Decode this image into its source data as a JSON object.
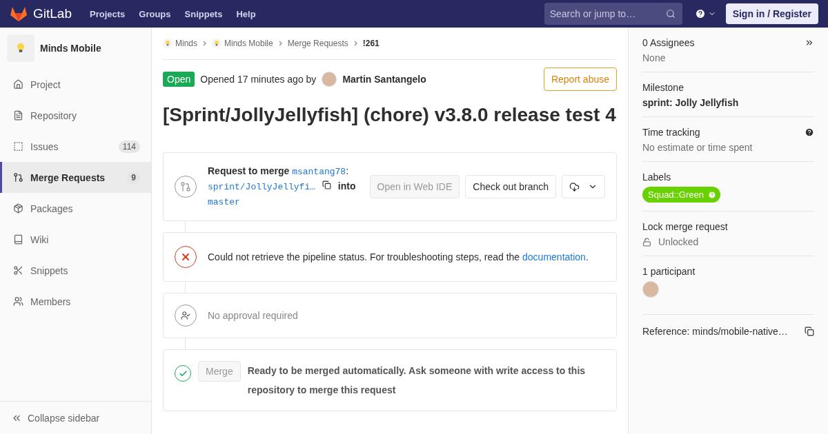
{
  "topbar": {
    "brand": "GitLab",
    "nav": [
      "Projects",
      "Groups",
      "Snippets",
      "Help"
    ],
    "search": {
      "placeholder": "Search or jump to…"
    },
    "signin": "Sign in / Register"
  },
  "sidebar": {
    "project": "Minds Mobile",
    "items": [
      {
        "label": "Project",
        "selected": false
      },
      {
        "label": "Repository",
        "selected": false
      },
      {
        "label": "Issues",
        "count": "114",
        "selected": false
      },
      {
        "label": "Merge Requests",
        "count": "9",
        "selected": true
      },
      {
        "label": "Packages",
        "selected": false
      },
      {
        "label": "Wiki",
        "selected": false
      },
      {
        "label": "Snippets",
        "selected": false
      },
      {
        "label": "Members",
        "selected": false
      }
    ],
    "collapse": "Collapse sidebar"
  },
  "breadcrumbs": [
    "Minds",
    "Minds Mobile",
    "Merge Requests",
    "!261"
  ],
  "header": {
    "status": "Open",
    "opened": "Opened 17 minutes ago by",
    "author": "Martin Santangelo",
    "report": "Report abuse"
  },
  "title": "[Sprint/JollyJellyfish] (chore) v3.8.0 release test 4",
  "merge_info": {
    "prefix": "Request to merge",
    "source_user": "msantang78",
    "separator": ":",
    "source_branch": "sprint/JollyJellyfi…",
    "into": "into",
    "target": "master",
    "web_ide": {
      "label": "Open in Web IDE",
      "disabled": true
    },
    "checkout": "Check out branch"
  },
  "pipeline": {
    "text": "Could not retrieve the pipeline status. For troubleshooting steps, read the",
    "link": "documentation",
    "end": "."
  },
  "approval": {
    "text": "No approval required"
  },
  "merge": {
    "button": {
      "label": "Merge",
      "disabled": true
    },
    "text": "Ready to be merged automatically. Ask someone with write access to this repository to merge this request"
  },
  "right_sidebar": {
    "assignees": {
      "title": "0 Assignees",
      "value": "None"
    },
    "milestone": {
      "title": "Milestone",
      "value": "sprint: Jolly Jellyfish"
    },
    "time_tracking": {
      "title": "Time tracking",
      "value": "No estimate or time spent"
    },
    "labels": {
      "title": "Labels",
      "items": [
        {
          "text": "Squad::Green",
          "color": "#69d100"
        }
      ]
    },
    "lock": {
      "title": "Lock merge request",
      "value": "Unlocked"
    },
    "participants": {
      "title": "1 participant"
    },
    "reference": "Reference: minds/mobile-native…"
  }
}
